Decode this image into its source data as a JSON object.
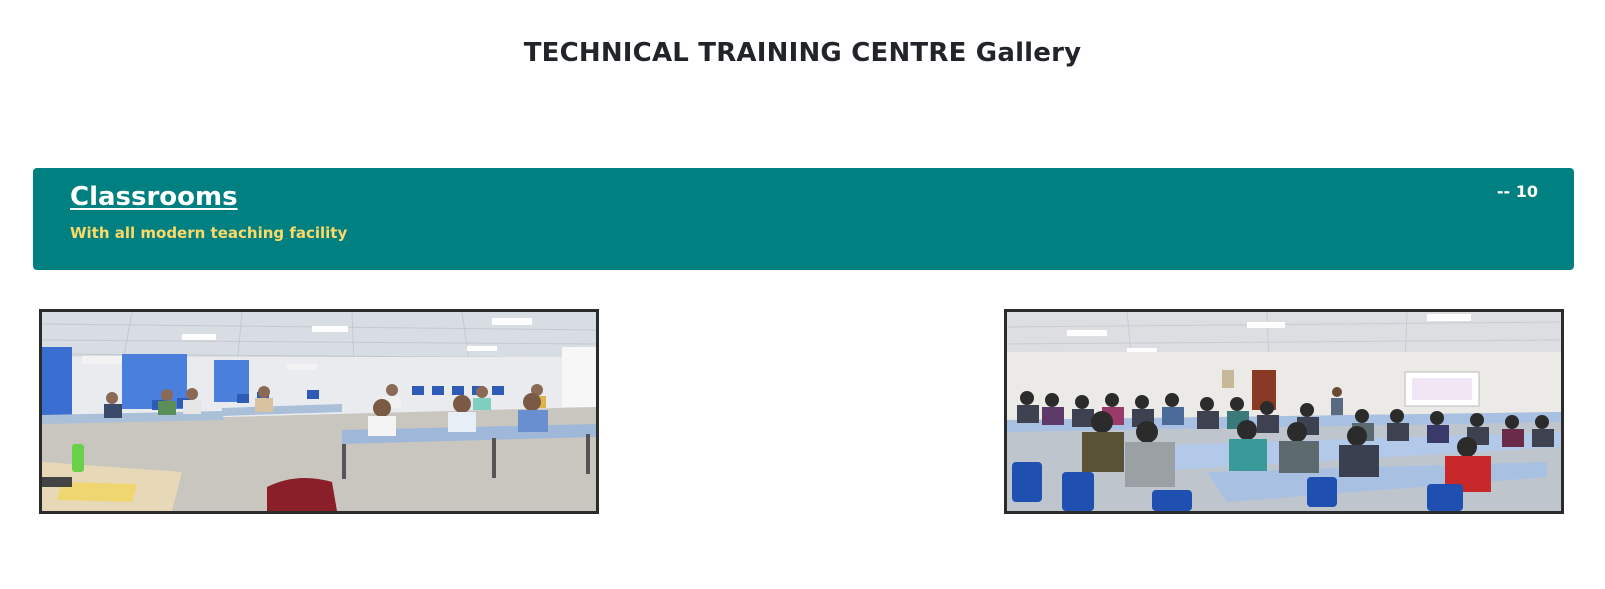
{
  "page": {
    "title": "TECHNICAL TRAINING CENTRE Gallery"
  },
  "section": {
    "title": "Classrooms",
    "subtitle": "With all modern teaching facility",
    "count": "-- 10"
  },
  "colors": {
    "banner": "#008080",
    "subtitle": "#ffd966",
    "photo_border": "#2b2b2b"
  },
  "gallery": {
    "images": [
      {
        "name": "classroom-photo-1"
      },
      {
        "name": "classroom-photo-2"
      }
    ]
  }
}
